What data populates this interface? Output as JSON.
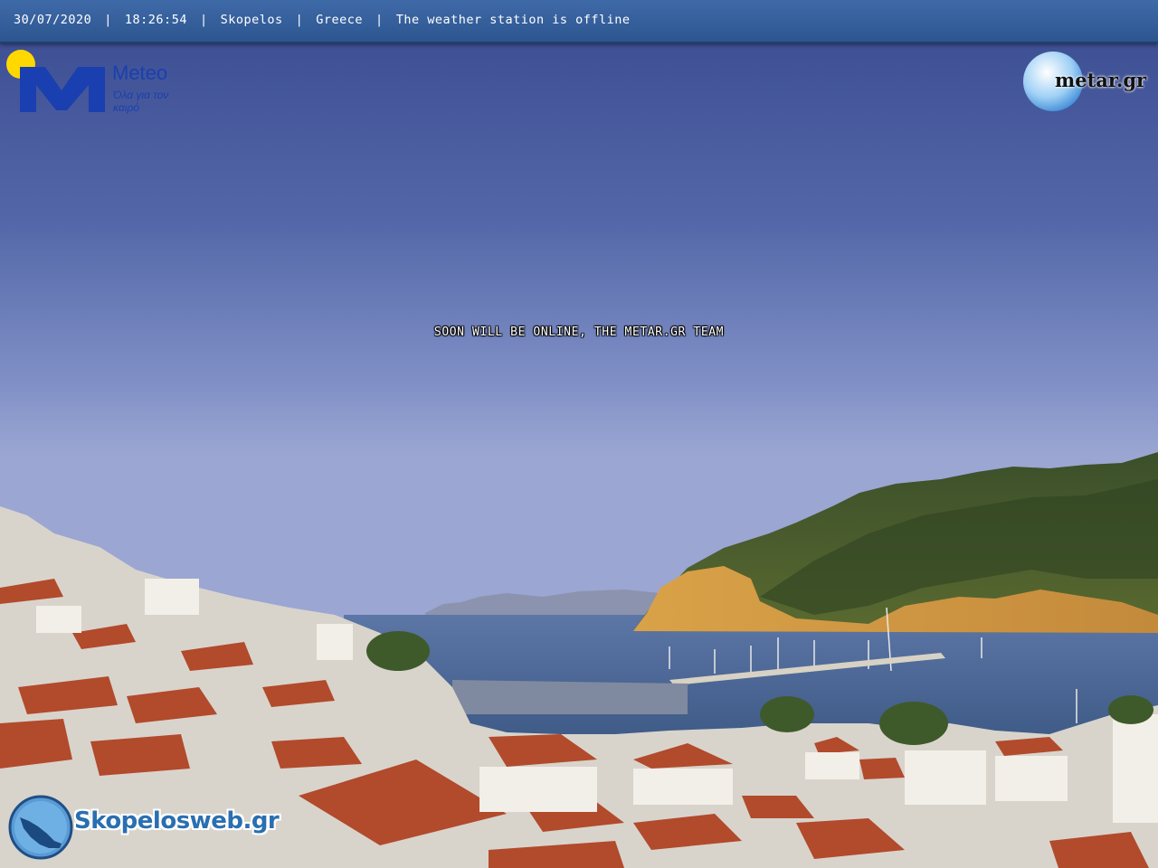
{
  "header": {
    "date": "30/07/2020",
    "time": "18:26:54",
    "location": "Skopelos",
    "country": "Greece",
    "status": "The weather station is offline",
    "separator": "|"
  },
  "overlay_message": "SOON WILL BE ONLINE, THE METAR.GR TEAM",
  "logos": {
    "meteo_title": "Meteo",
    "meteo_subtitle": "Όλα για τον καιρό",
    "metar": "metar.gr",
    "skopelos": "Skopelosweb.gr"
  },
  "colors": {
    "header_bar": "#2d5690",
    "meteo_blue": "#1a3fb0",
    "sun_yellow": "#ffd800",
    "sky_top": "#3e4f93",
    "sky_bottom": "#98a4d4"
  }
}
